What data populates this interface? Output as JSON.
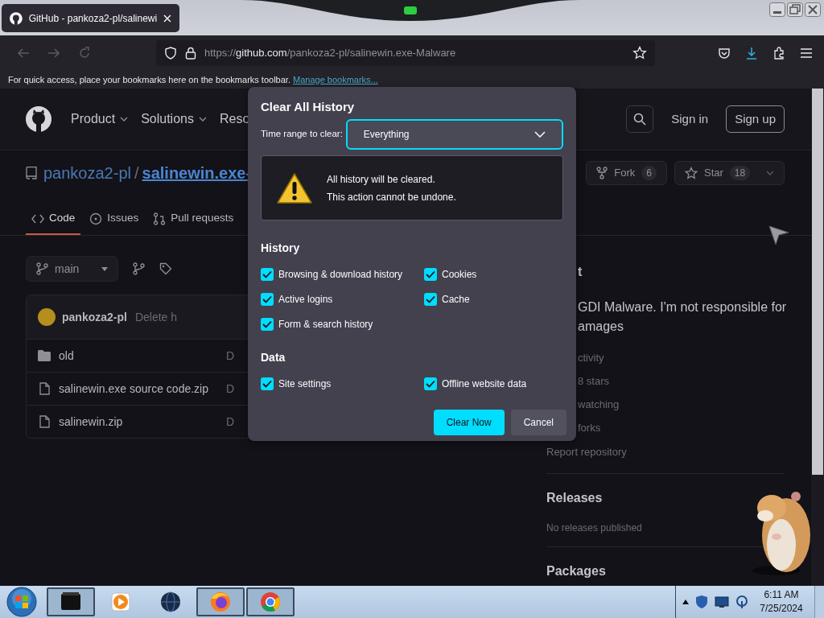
{
  "browser": {
    "tab": {
      "title": "GitHub - pankoza2-pl/salinewi",
      "selected": true
    },
    "url": {
      "scheme": "https://",
      "host": "github.com",
      "path": "/pankoza2-pl/salinewin.exe-Malware"
    },
    "bookmarks_hint": {
      "text": "For quick access, place your bookmarks here on the bookmarks toolbar.",
      "link": "Manage bookmarks..."
    }
  },
  "github": {
    "nav": [
      {
        "label": "Product",
        "dropdown": true
      },
      {
        "label": "Solutions",
        "dropdown": true
      },
      {
        "label": "Reso",
        "dropdown": false
      }
    ],
    "sign_in": "Sign in",
    "sign_up": "Sign up",
    "repo": {
      "owner": "pankoza2-pl",
      "separator": "/",
      "name": "salinewin.exe-"
    },
    "fork": {
      "label": "Fork",
      "count": "6"
    },
    "star": {
      "label": "Star",
      "count": "18"
    },
    "tabs": [
      {
        "label": "Code",
        "kind": "code",
        "selected": true
      },
      {
        "label": "Issues",
        "kind": "issues",
        "selected": false
      },
      {
        "label": "Pull requests",
        "kind": "pulls",
        "selected": false
      }
    ],
    "branch": "main",
    "commit": {
      "author": "pankoza2-pl",
      "message": "Delete h"
    },
    "files": [
      {
        "kind": "folder",
        "name": "old",
        "column_2": "D"
      },
      {
        "kind": "file",
        "name": "salinewin.exe source code.zip",
        "column_2": "D"
      },
      {
        "kind": "file",
        "name": "salinewin.zip",
        "column_2": "D"
      }
    ],
    "about": {
      "heading": "t",
      "description_lines": [
        "GDI Malware. I'm not responsible for",
        "amages"
      ],
      "stats": [
        "ctivity",
        "8 stars",
        "watching",
        "forks"
      ],
      "report": "Report repository"
    },
    "releases": {
      "heading": "Releases",
      "text": "No releases published"
    },
    "packages": {
      "heading": "Packages"
    }
  },
  "dialog": {
    "title": "Clear All History",
    "range_label": "Time range to clear:",
    "range_value": "Everything",
    "warning_lines": [
      "All history will be cleared.",
      "This action cannot be undone."
    ],
    "sections": [
      {
        "heading": "History",
        "options": [
          {
            "label": "Browsing & download history",
            "checked": true
          },
          {
            "label": "Cookies",
            "checked": true
          },
          {
            "label": "Active logins",
            "checked": true
          },
          {
            "label": "Cache",
            "checked": true
          },
          {
            "label": "Form & search history",
            "checked": true
          }
        ]
      },
      {
        "heading": "Data",
        "options": [
          {
            "label": "Site settings",
            "checked": true
          },
          {
            "label": "Offline website data",
            "checked": true
          }
        ]
      }
    ],
    "buttons": [
      {
        "label": "Clear Now",
        "kind": "primary"
      },
      {
        "label": "Cancel",
        "kind": "secondary"
      }
    ]
  },
  "taskbar": {
    "apps": [
      {
        "kind": "terminal",
        "open": true
      },
      {
        "kind": "media",
        "open": false
      },
      {
        "kind": "globe",
        "open": false
      },
      {
        "kind": "firefox",
        "open": true
      },
      {
        "kind": "chrome",
        "open": true
      }
    ],
    "time": "6:11 AM",
    "date": "7/25/2024"
  }
}
